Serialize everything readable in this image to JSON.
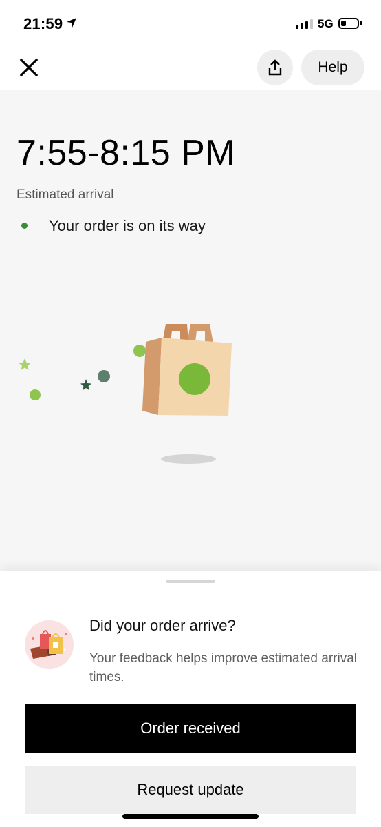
{
  "status_bar": {
    "time": "21:59",
    "network": "5G"
  },
  "nav": {
    "help_label": "Help"
  },
  "tracking": {
    "eta": "7:55-8:15 PM",
    "eta_label": "Estimated arrival",
    "status": "Your order is on its way"
  },
  "feedback": {
    "title": "Did your order arrive?",
    "subtitle": "Your feedback helps improve estimated arrival times.",
    "primary_label": "Order received",
    "secondary_label": "Request update"
  },
  "colors": {
    "status_dot": "#3a8a3e",
    "bag_front": "#f3d6ac",
    "bag_side": "#d39b6c",
    "bag_dot": "#7ab83a",
    "primary_button": "#000000"
  },
  "icons": [
    "location-arrow-icon",
    "signal-icon",
    "battery-icon",
    "close-icon",
    "share-icon",
    "shopping-bag-illustration",
    "feedback-bags-icon"
  ]
}
